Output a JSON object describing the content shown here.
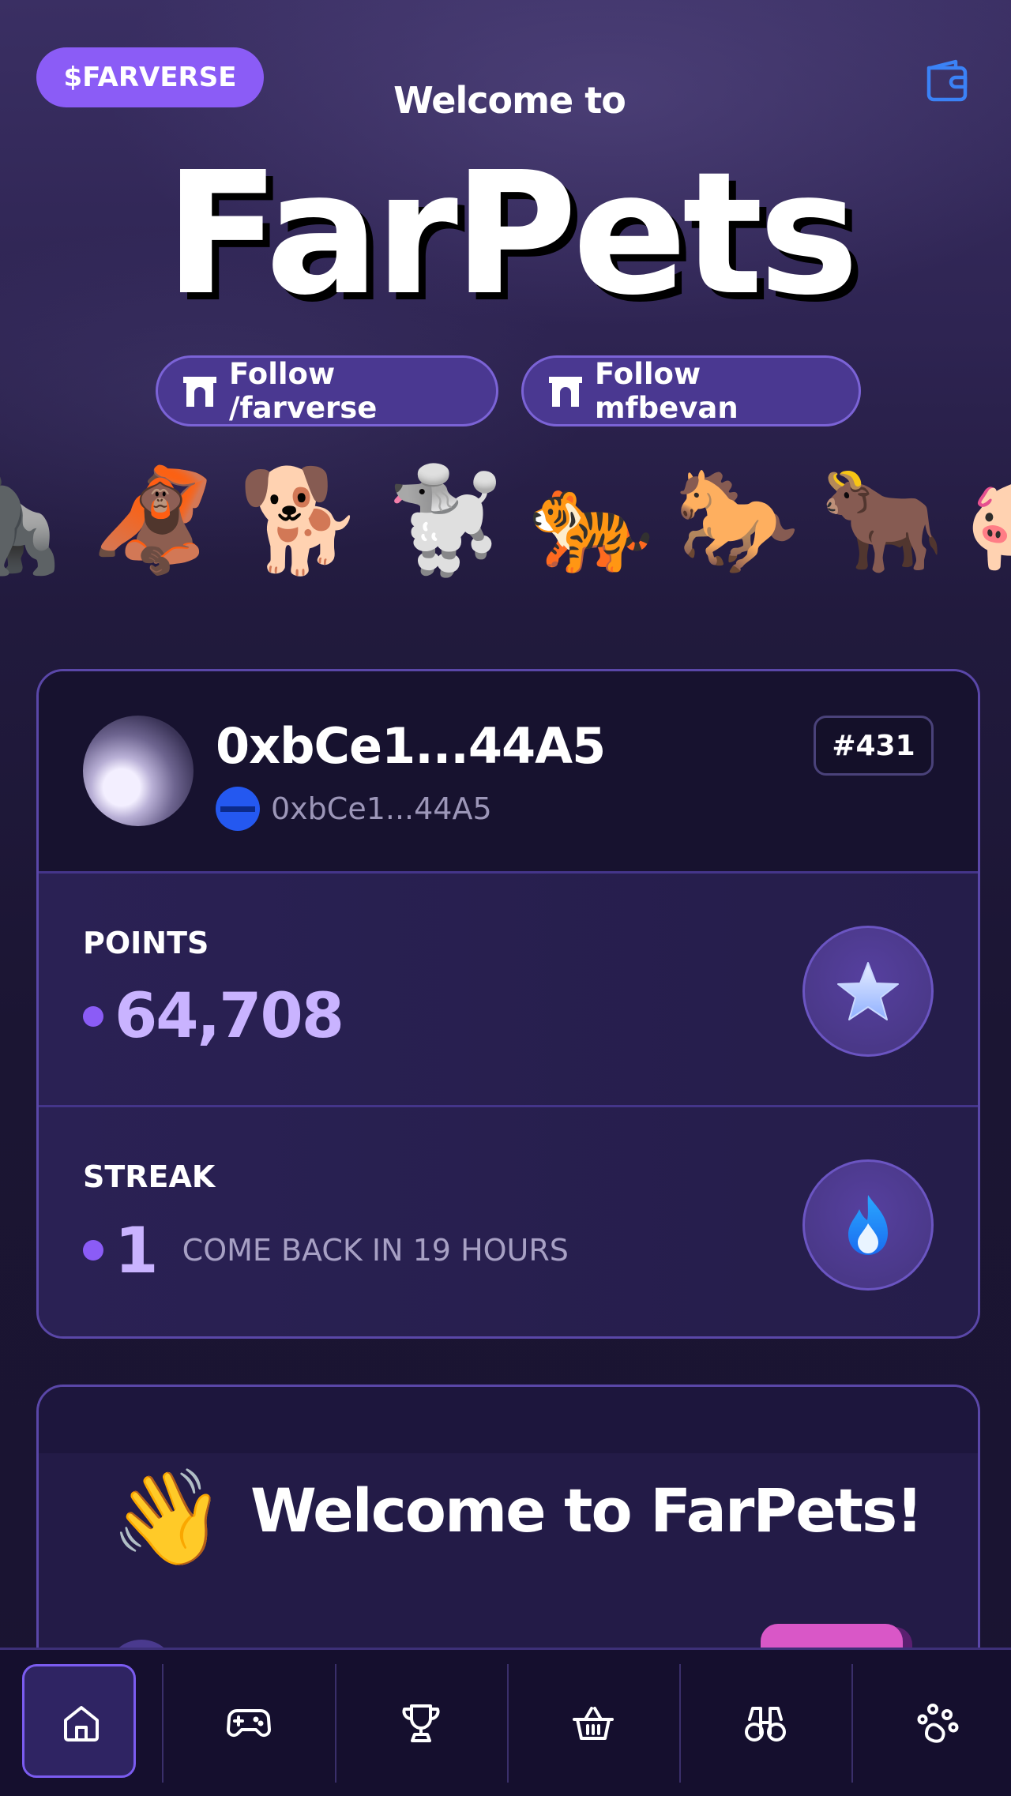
{
  "header": {
    "token_label": "$FARVERSE",
    "welcome_prefix": "Welcome to",
    "app_title": "FarPets",
    "wallet_icon": "wallet-icon",
    "follow_buttons": [
      {
        "label": "Follow /farverse",
        "icon": "arch-icon"
      },
      {
        "label": "Follow mfbevan",
        "icon": "arch-icon"
      }
    ]
  },
  "pets_strip": [
    "🦍",
    "🦧",
    "🐕",
    "🐩",
    "🐅",
    "🐎",
    "🐂",
    "🐖"
  ],
  "profile": {
    "display_name": "0xbCe1...44A5",
    "address": "0xbCe1...44A5",
    "rank": "#431",
    "points": {
      "label": "POINTS",
      "value": "64,708",
      "icon": "star-icon"
    },
    "streak": {
      "label": "STREAK",
      "value": "1",
      "note": "COME BACK IN 19 HOURS",
      "icon": "flame-icon"
    }
  },
  "welcome_card": {
    "emoji": "👋",
    "heading": "Welcome to FarPets!"
  },
  "nav": {
    "items": [
      {
        "name": "home",
        "icon": "home-icon",
        "active": true
      },
      {
        "name": "games",
        "icon": "gamepad-icon",
        "active": false
      },
      {
        "name": "leaderboard",
        "icon": "trophy-icon",
        "active": false
      },
      {
        "name": "shop",
        "icon": "basket-icon",
        "active": false
      },
      {
        "name": "explore",
        "icon": "binoculars-icon",
        "active": false
      },
      {
        "name": "pets",
        "icon": "paw-icon",
        "active": false
      }
    ]
  },
  "colors": {
    "accent": "#8b5cf6",
    "points_text": "#c9b3ff",
    "wallet_icon": "#3b82f6",
    "chain_badge": "#2458f0"
  }
}
